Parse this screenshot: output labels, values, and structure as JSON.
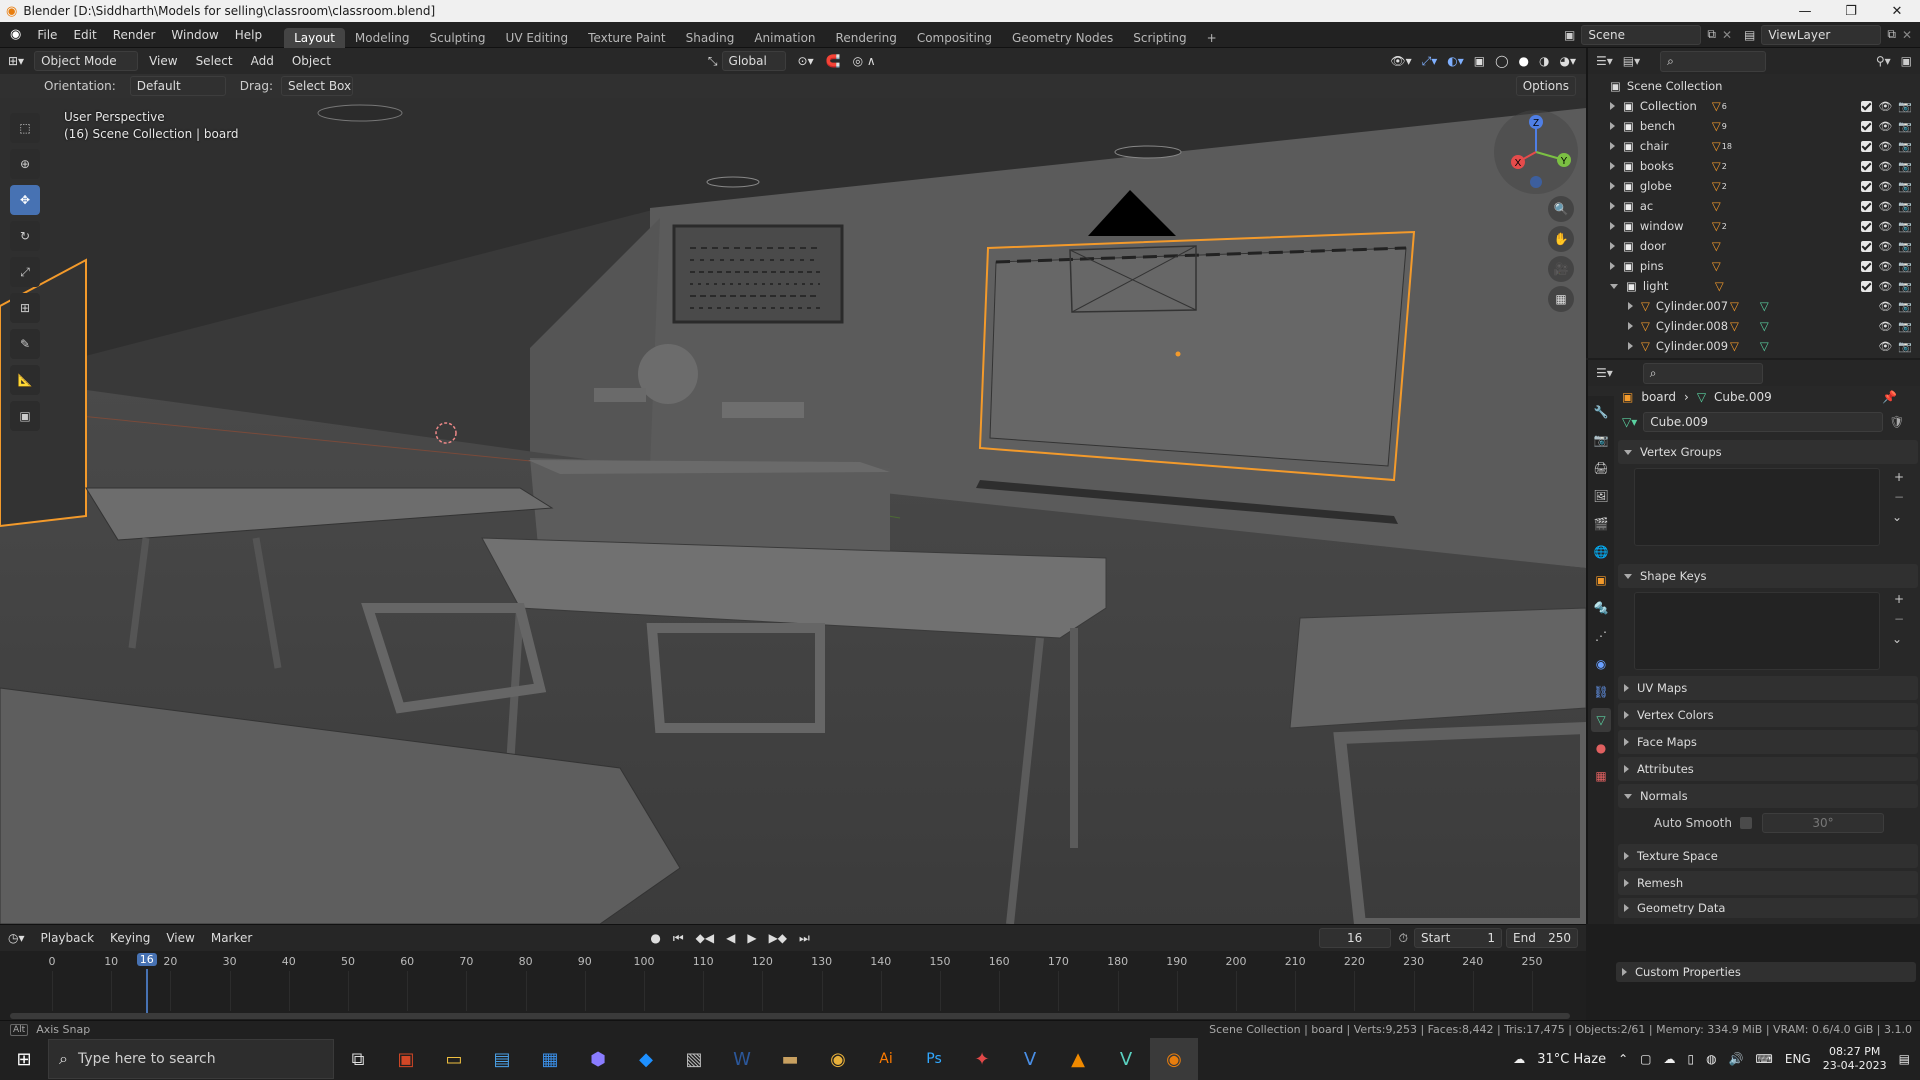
{
  "titlebar": {
    "title": "Blender [D:\\Siddharth\\Models for selling\\classroom\\classroom.blend]"
  },
  "menu": [
    "File",
    "Edit",
    "Render",
    "Window",
    "Help"
  ],
  "workspaces": [
    "Layout",
    "Modeling",
    "Sculpting",
    "UV Editing",
    "Texture Paint",
    "Shading",
    "Animation",
    "Rendering",
    "Compositing",
    "Geometry Nodes",
    "Scripting",
    "+"
  ],
  "scene": {
    "scene_name": "Scene",
    "view_layer": "ViewLayer"
  },
  "viewport": {
    "mode": "Object Mode",
    "menus": [
      "View",
      "Select",
      "Add",
      "Object"
    ],
    "transform": "Global",
    "orientation_label": "Orientation:",
    "orientation_value": "Default",
    "drag_label": "Drag:",
    "drag_value": "Select Box",
    "options": "Options",
    "overlay_line1": "User Perspective",
    "overlay_line2": "(16) Scene Collection | board",
    "gizmo": {
      "z": "Z",
      "x": "X",
      "y": "Y"
    }
  },
  "outliner": {
    "root": "Scene Collection",
    "rows": [
      {
        "name": "Collection",
        "badge": "6",
        "child": false,
        "expanded": false
      },
      {
        "name": "bench",
        "badge": "9",
        "child": false,
        "expanded": false
      },
      {
        "name": "chair",
        "badge": "18",
        "child": false,
        "expanded": false
      },
      {
        "name": "books",
        "badge": "2",
        "child": false,
        "expanded": false
      },
      {
        "name": "globe",
        "badge": "2",
        "child": false,
        "expanded": false
      },
      {
        "name": "ac",
        "badge": "",
        "child": false,
        "expanded": false
      },
      {
        "name": "window",
        "badge": "2",
        "child": false,
        "expanded": false
      },
      {
        "name": "door",
        "badge": "",
        "child": false,
        "expanded": false
      },
      {
        "name": "pins",
        "badge": "",
        "child": false,
        "expanded": false
      },
      {
        "name": "light",
        "badge": "",
        "child": false,
        "expanded": true
      },
      {
        "name": "Cylinder.007",
        "badge": "",
        "child": true,
        "expanded": false
      },
      {
        "name": "Cylinder.008",
        "badge": "",
        "child": true,
        "expanded": false
      },
      {
        "name": "Cylinder.009",
        "badge": "",
        "child": true,
        "expanded": false
      }
    ]
  },
  "properties": {
    "breadcrumb_object": "board",
    "breadcrumb_mesh": "Cube.009",
    "mesh_name": "Cube.009",
    "panels": {
      "vertex_groups": "Vertex Groups",
      "shape_keys": "Shape Keys",
      "uv_maps": "UV Maps",
      "vertex_colors": "Vertex Colors",
      "face_maps": "Face Maps",
      "attributes": "Attributes",
      "normals": "Normals",
      "auto_smooth": "Auto Smooth",
      "auto_smooth_angle": "30°",
      "texture_space": "Texture Space",
      "remesh": "Remesh",
      "geometry_data": "Geometry Data",
      "custom_properties": "Custom Properties"
    }
  },
  "timeline": {
    "menus": [
      "Playback",
      "Keying",
      "View",
      "Marker"
    ],
    "current_frame": "16",
    "start_label": "Start",
    "start": "1",
    "end_label": "End",
    "end": "250",
    "ticks": [
      "0",
      "10",
      "20",
      "30",
      "40",
      "50",
      "60",
      "70",
      "80",
      "90",
      "100",
      "110",
      "120",
      "130",
      "140",
      "150",
      "160",
      "170",
      "180",
      "190",
      "200",
      "210",
      "220",
      "230",
      "240",
      "250"
    ],
    "playhead": 16
  },
  "statusbar": {
    "left": "Axis Snap",
    "right": "Scene Collection | board | Verts:9,253 | Faces:8,442 | Tris:17,475 | Objects:2/61 | Memory: 334.9 MiB | VRAM: 0.6/4.0 GiB | 3.1.0"
  },
  "taskbar": {
    "search_placeholder": "Type here to search",
    "weather": "31°C  Haze",
    "lang": "ENG",
    "time": "08:27 PM",
    "date": "23-04-2023"
  },
  "colors": {
    "accent": "#4772b3",
    "selection": "#f39a2b",
    "viewport": "#3a3a3a"
  }
}
